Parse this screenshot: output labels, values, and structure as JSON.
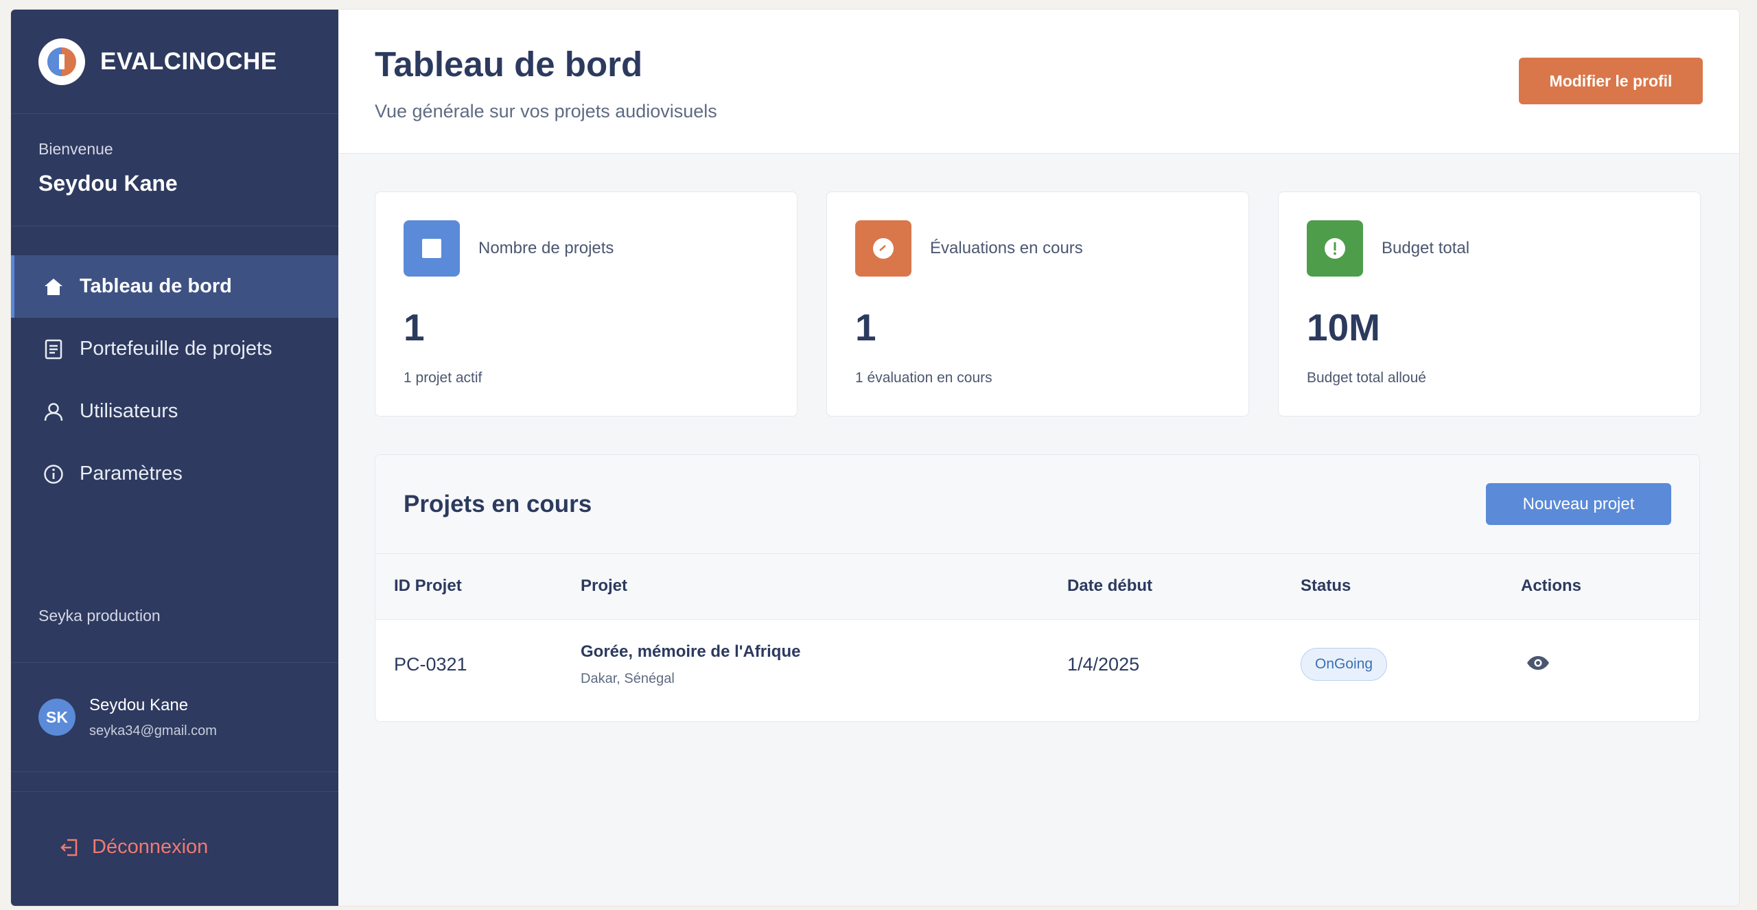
{
  "brand": {
    "name": "EVALCINOCHE"
  },
  "sidebar": {
    "welcome_label": "Bienvenue",
    "welcome_name": "Seydou Kane",
    "items": [
      {
        "label": "Tableau de bord",
        "icon": "home-icon",
        "active": true
      },
      {
        "label": "Portefeuille de projets",
        "icon": "document-icon"
      },
      {
        "label": "Utilisateurs",
        "icon": "user-icon"
      },
      {
        "label": "Paramètres",
        "icon": "info-icon"
      }
    ],
    "company": "Seyka production",
    "user": {
      "initials": "SK",
      "name": "Seydou Kane",
      "email": "seyka34@gmail.com"
    },
    "logout_label": "Déconnexion"
  },
  "header": {
    "title": "Tableau de bord",
    "subtitle": "Vue générale sur vos projets audiovisuels",
    "edit_profile_label": "Modifier le profil"
  },
  "cards": [
    {
      "label": "Nombre de projets",
      "value": "1",
      "sub": "1 projet actif",
      "icon": "square-icon",
      "color": "#5b8ad8"
    },
    {
      "label": "Évaluations en cours",
      "value": "1",
      "sub": "1 évaluation en cours",
      "icon": "clock-icon",
      "color": "#d9774a"
    },
    {
      "label": "Budget total",
      "value": "10M",
      "sub": "Budget total alloué",
      "icon": "alert-icon",
      "color": "#4e9d4a"
    }
  ],
  "projects": {
    "title": "Projets en cours",
    "new_label": "Nouveau projet",
    "columns": [
      "ID Projet",
      "Projet",
      "Date début",
      "Status",
      "Actions"
    ],
    "rows": [
      {
        "id": "PC-0321",
        "name": "Gorée, mémoire de l'Afrique",
        "location": "Dakar, Sénégal",
        "date": "1/4/2025",
        "status": "OnGoing"
      }
    ]
  },
  "colors": {
    "sidebar": "#2e3a5f",
    "accent_blue": "#5b8ad8",
    "accent_orange": "#d9774a",
    "accent_green": "#4e9d4a",
    "logout_red": "#f07a72"
  }
}
